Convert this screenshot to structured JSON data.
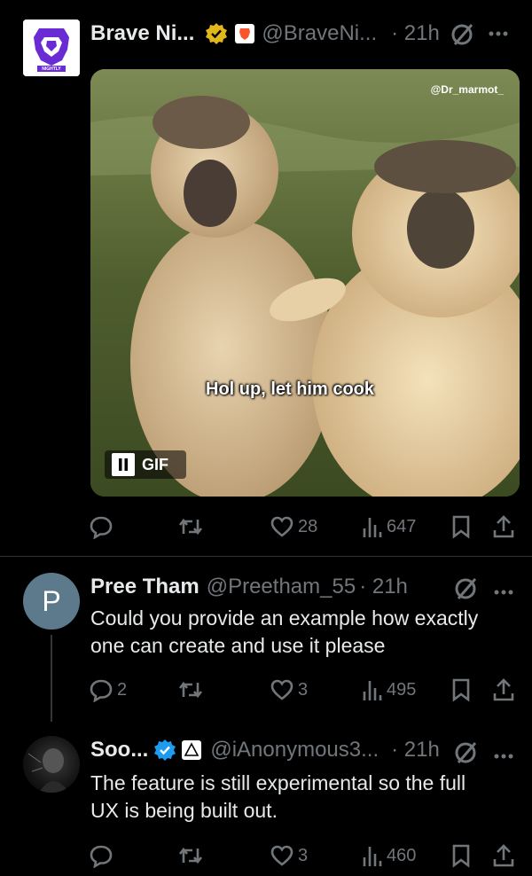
{
  "tweets": [
    {
      "name": "Brave Ni...",
      "handle": "@BraveNi...",
      "time": "· 21h",
      "avatar_label": "NIGHTLY",
      "media": {
        "watermark": "@Dr_marmot_",
        "caption": "Hol up, let him cook",
        "badge": "GIF"
      },
      "replies": "",
      "retweets": "",
      "likes": "28",
      "views": "647"
    },
    {
      "name": "Pree Tham",
      "handle": "@Preetham_55",
      "time": "· 21h",
      "avatar_letter": "P",
      "text_line1": "Could you provide an example how exactly",
      "text_line2": "one can create and use it please",
      "replies": "2",
      "retweets": "",
      "likes": "3",
      "views": "495"
    },
    {
      "name": "Soo...",
      "handle": "@iAnonymous3...",
      "time": "· 21h",
      "text_line1": "The feature is still experimental so the full",
      "text_line2": "UX is being built out.",
      "replies": "",
      "retweets": "",
      "likes": "3",
      "views": "460"
    }
  ],
  "colors": {
    "background": "#000000",
    "text": "#e7e9ea",
    "muted": "#71767b",
    "verified_gold": "#e2b719",
    "verified_blue": "#1d9bf0",
    "brave_purple": "#6a2bd4"
  },
  "icons": [
    "reply-icon",
    "retweet-icon",
    "like-icon",
    "views-icon",
    "bookmark-icon",
    "share-icon",
    "grok-icon",
    "more-icon",
    "verified-badge-icon",
    "affiliate-badge-icon",
    "pause-icon"
  ]
}
